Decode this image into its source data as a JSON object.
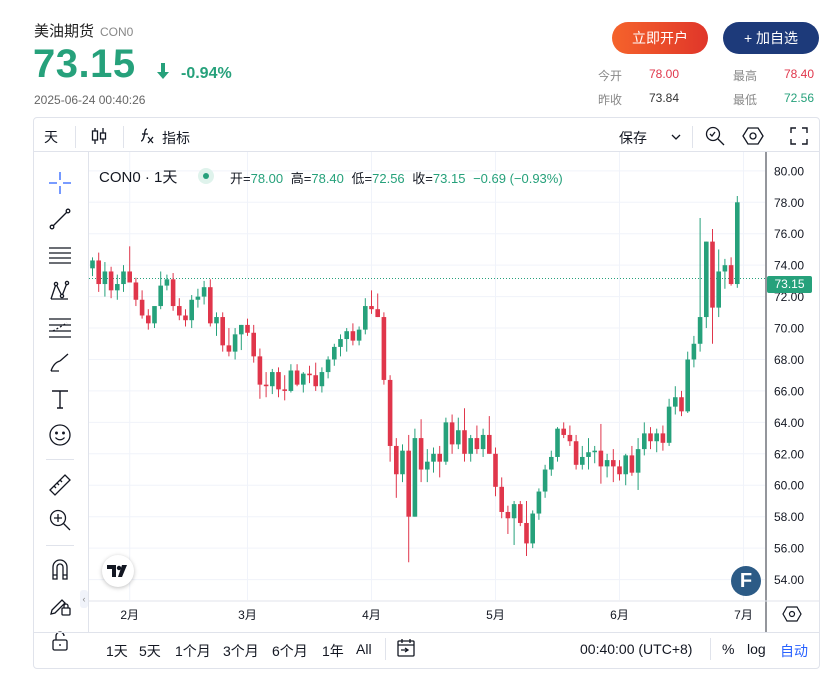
{
  "header": {
    "name": "美油期货",
    "code": "CON0",
    "price": "73.15",
    "change_pct": "-0.94%",
    "timestamp": "2025-06-24 00:40:26",
    "open_account_label": "立即开户",
    "add_watch_label": "+ 加自选"
  },
  "stats": {
    "open_label": "今开",
    "open_value": "78.00",
    "high_label": "最高",
    "high_value": "78.40",
    "prev_close_label": "昨收",
    "prev_close_value": "73.84",
    "low_label": "最低",
    "low_value": "72.56"
  },
  "toolbar": {
    "interval": "天",
    "indicators_label": "指标",
    "save_label": "保存"
  },
  "legend": {
    "symbol": "CON0 · 1天",
    "open_label": "开=",
    "open": "78.00",
    "high_label": "高=",
    "high": "78.40",
    "low_label": "低=",
    "low": "72.56",
    "close_label": "收=",
    "close": "73.15",
    "change": "−0.69 (−0.93%)"
  },
  "price_badge": "73.15",
  "bottom_bar": {
    "ranges": [
      "1天",
      "5天",
      "1个月",
      "3个月",
      "6个月",
      "1年",
      "All"
    ],
    "time": "00:40:00 (UTC+8)",
    "pct_label": "%",
    "log_label": "log",
    "auto_label": "自动"
  },
  "colors": {
    "up": "#26a17b",
    "down": "#e0364b",
    "accent": "#2962ff"
  },
  "chart_data": {
    "type": "candlestick",
    "y_ticks": [
      "80.00",
      "78.00",
      "76.00",
      "74.00",
      "72.00",
      "70.00",
      "68.00",
      "66.00",
      "64.00",
      "62.00",
      "60.00",
      "58.00",
      "56.00",
      "54.00"
    ],
    "ylim": [
      52.7,
      81.2
    ],
    "x_labels": [
      {
        "label": "2月",
        "index": 6
      },
      {
        "label": "3月",
        "index": 25
      },
      {
        "label": "4月",
        "index": 45
      },
      {
        "label": "5月",
        "index": 65
      },
      {
        "label": "6月",
        "index": 85
      },
      {
        "label": "7月",
        "index": 105
      }
    ],
    "last_price_line": 73.15,
    "candles": [
      {
        "o": 73.8,
        "h": 74.5,
        "l": 73.3,
        "c": 74.3
      },
      {
        "o": 74.3,
        "h": 74.8,
        "l": 72.3,
        "c": 72.8
      },
      {
        "o": 72.8,
        "h": 74.2,
        "l": 72.0,
        "c": 73.6
      },
      {
        "o": 73.6,
        "h": 73.9,
        "l": 71.9,
        "c": 72.4
      },
      {
        "o": 72.4,
        "h": 73.4,
        "l": 71.8,
        "c": 72.8
      },
      {
        "o": 72.8,
        "h": 74.0,
        "l": 72.3,
        "c": 73.6
      },
      {
        "o": 73.6,
        "h": 75.2,
        "l": 73.0,
        "c": 72.9
      },
      {
        "o": 72.9,
        "h": 73.2,
        "l": 71.4,
        "c": 71.8
      },
      {
        "o": 71.8,
        "h": 72.4,
        "l": 70.6,
        "c": 70.8
      },
      {
        "o": 70.8,
        "h": 71.2,
        "l": 69.9,
        "c": 70.3
      },
      {
        "o": 70.3,
        "h": 71.0,
        "l": 70.0,
        "c": 71.4
      },
      {
        "o": 71.4,
        "h": 73.6,
        "l": 71.2,
        "c": 72.7
      },
      {
        "o": 72.7,
        "h": 73.4,
        "l": 72.4,
        "c": 73.1
      },
      {
        "o": 73.1,
        "h": 73.5,
        "l": 71.1,
        "c": 71.4
      },
      {
        "o": 71.4,
        "h": 71.9,
        "l": 70.5,
        "c": 70.8
      },
      {
        "o": 70.8,
        "h": 71.2,
        "l": 70.1,
        "c": 70.5
      },
      {
        "o": 70.5,
        "h": 72.1,
        "l": 70.0,
        "c": 71.8
      },
      {
        "o": 71.8,
        "h": 72.5,
        "l": 71.3,
        "c": 72.0
      },
      {
        "o": 72.0,
        "h": 73.0,
        "l": 71.5,
        "c": 72.6
      },
      {
        "o": 72.6,
        "h": 73.1,
        "l": 70.1,
        "c": 70.3
      },
      {
        "o": 70.3,
        "h": 71.0,
        "l": 69.5,
        "c": 70.7
      },
      {
        "o": 70.7,
        "h": 71.0,
        "l": 68.5,
        "c": 68.9
      },
      {
        "o": 68.9,
        "h": 70.0,
        "l": 68.2,
        "c": 68.5
      },
      {
        "o": 68.5,
        "h": 70.0,
        "l": 68.0,
        "c": 69.6
      },
      {
        "o": 69.6,
        "h": 70.2,
        "l": 68.6,
        "c": 70.2
      },
      {
        "o": 70.2,
        "h": 70.6,
        "l": 69.5,
        "c": 69.7
      },
      {
        "o": 69.7,
        "h": 70.2,
        "l": 67.8,
        "c": 68.2
      },
      {
        "o": 68.2,
        "h": 68.7,
        "l": 65.5,
        "c": 66.4
      },
      {
        "o": 66.4,
        "h": 67.2,
        "l": 65.6,
        "c": 66.3
      },
      {
        "o": 66.3,
        "h": 67.4,
        "l": 65.8,
        "c": 67.2
      },
      {
        "o": 67.2,
        "h": 67.5,
        "l": 65.6,
        "c": 66.1
      },
      {
        "o": 66.1,
        "h": 67.0,
        "l": 65.4,
        "c": 66.0
      },
      {
        "o": 66.0,
        "h": 67.7,
        "l": 65.9,
        "c": 67.3
      },
      {
        "o": 67.3,
        "h": 67.7,
        "l": 66.3,
        "c": 66.4
      },
      {
        "o": 66.4,
        "h": 67.2,
        "l": 65.9,
        "c": 67.1
      },
      {
        "o": 67.1,
        "h": 67.6,
        "l": 66.5,
        "c": 67.0
      },
      {
        "o": 67.0,
        "h": 67.8,
        "l": 66.0,
        "c": 66.3
      },
      {
        "o": 66.3,
        "h": 67.5,
        "l": 65.9,
        "c": 67.2
      },
      {
        "o": 67.2,
        "h": 68.2,
        "l": 66.8,
        "c": 68.0
      },
      {
        "o": 68.0,
        "h": 69.0,
        "l": 67.6,
        "c": 68.8
      },
      {
        "o": 68.8,
        "h": 69.6,
        "l": 68.2,
        "c": 69.3
      },
      {
        "o": 69.3,
        "h": 70.0,
        "l": 68.5,
        "c": 69.8
      },
      {
        "o": 69.8,
        "h": 70.3,
        "l": 68.9,
        "c": 69.2
      },
      {
        "o": 69.2,
        "h": 70.1,
        "l": 68.9,
        "c": 69.9
      },
      {
        "o": 69.9,
        "h": 71.9,
        "l": 69.6,
        "c": 71.4
      },
      {
        "o": 71.4,
        "h": 72.4,
        "l": 70.9,
        "c": 71.2
      },
      {
        "o": 71.2,
        "h": 72.2,
        "l": 70.7,
        "c": 70.7
      },
      {
        "o": 70.7,
        "h": 71.0,
        "l": 66.4,
        "c": 66.7
      },
      {
        "o": 66.7,
        "h": 67.0,
        "l": 61.5,
        "c": 62.5
      },
      {
        "o": 62.5,
        "h": 63.0,
        "l": 59.2,
        "c": 60.7
      },
      {
        "o": 60.7,
        "h": 62.6,
        "l": 60.2,
        "c": 62.2
      },
      {
        "o": 62.2,
        "h": 63.2,
        "l": 55.1,
        "c": 58.0
      },
      {
        "o": 58.0,
        "h": 63.6,
        "l": 58.0,
        "c": 63.0
      },
      {
        "o": 63.0,
        "h": 64.2,
        "l": 60.2,
        "c": 61.0
      },
      {
        "o": 61.0,
        "h": 62.3,
        "l": 60.2,
        "c": 61.5
      },
      {
        "o": 61.5,
        "h": 62.4,
        "l": 60.8,
        "c": 62.0
      },
      {
        "o": 62.0,
        "h": 62.5,
        "l": 60.5,
        "c": 61.5
      },
      {
        "o": 61.5,
        "h": 64.3,
        "l": 61.3,
        "c": 64.0
      },
      {
        "o": 64.0,
        "h": 64.5,
        "l": 62.0,
        "c": 62.6
      },
      {
        "o": 62.6,
        "h": 64.3,
        "l": 62.3,
        "c": 63.5
      },
      {
        "o": 63.5,
        "h": 64.9,
        "l": 61.5,
        "c": 62.0
      },
      {
        "o": 62.0,
        "h": 63.2,
        "l": 61.5,
        "c": 63.0
      },
      {
        "o": 63.0,
        "h": 63.8,
        "l": 62.0,
        "c": 62.3
      },
      {
        "o": 62.3,
        "h": 63.6,
        "l": 61.8,
        "c": 63.2
      },
      {
        "o": 63.2,
        "h": 64.4,
        "l": 62.0,
        "c": 62.0
      },
      {
        "o": 62.0,
        "h": 62.4,
        "l": 59.3,
        "c": 59.9
      },
      {
        "o": 59.9,
        "h": 60.5,
        "l": 57.9,
        "c": 58.3
      },
      {
        "o": 58.3,
        "h": 58.7,
        "l": 56.9,
        "c": 57.9
      },
      {
        "o": 57.9,
        "h": 59.0,
        "l": 56.2,
        "c": 58.8
      },
      {
        "o": 58.8,
        "h": 59.0,
        "l": 57.4,
        "c": 57.6
      },
      {
        "o": 57.6,
        "h": 59.0,
        "l": 55.5,
        "c": 56.3
      },
      {
        "o": 56.3,
        "h": 58.4,
        "l": 56.0,
        "c": 58.2
      },
      {
        "o": 58.2,
        "h": 59.8,
        "l": 57.8,
        "c": 59.6
      },
      {
        "o": 59.6,
        "h": 61.3,
        "l": 59.2,
        "c": 61.0
      },
      {
        "o": 61.0,
        "h": 62.2,
        "l": 60.6,
        "c": 61.8
      },
      {
        "o": 61.8,
        "h": 63.7,
        "l": 61.5,
        "c": 63.6
      },
      {
        "o": 63.6,
        "h": 64.0,
        "l": 63.0,
        "c": 63.2
      },
      {
        "o": 63.2,
        "h": 63.8,
        "l": 62.5,
        "c": 62.8
      },
      {
        "o": 62.8,
        "h": 63.2,
        "l": 61.0,
        "c": 61.3
      },
      {
        "o": 61.3,
        "h": 62.5,
        "l": 61.0,
        "c": 61.8
      },
      {
        "o": 61.8,
        "h": 63.0,
        "l": 61.0,
        "c": 62.1
      },
      {
        "o": 62.1,
        "h": 62.5,
        "l": 61.4,
        "c": 62.2
      },
      {
        "o": 62.2,
        "h": 63.9,
        "l": 60.1,
        "c": 61.2
      },
      {
        "o": 61.2,
        "h": 62.0,
        "l": 60.5,
        "c": 61.6
      },
      {
        "o": 61.6,
        "h": 62.3,
        "l": 60.2,
        "c": 61.2
      },
      {
        "o": 61.2,
        "h": 61.6,
        "l": 60.3,
        "c": 60.7
      },
      {
        "o": 60.7,
        "h": 62.0,
        "l": 60.0,
        "c": 61.9
      },
      {
        "o": 61.9,
        "h": 62.5,
        "l": 60.6,
        "c": 60.8
      },
      {
        "o": 60.8,
        "h": 63.0,
        "l": 59.7,
        "c": 62.3
      },
      {
        "o": 62.3,
        "h": 64.0,
        "l": 61.9,
        "c": 63.3
      },
      {
        "o": 63.3,
        "h": 63.7,
        "l": 62.3,
        "c": 62.8
      },
      {
        "o": 62.8,
        "h": 63.6,
        "l": 62.1,
        "c": 63.3
      },
      {
        "o": 63.3,
        "h": 63.8,
        "l": 62.2,
        "c": 62.7
      },
      {
        "o": 62.7,
        "h": 65.5,
        "l": 62.5,
        "c": 65.0
      },
      {
        "o": 65.0,
        "h": 66.3,
        "l": 64.5,
        "c": 65.6
      },
      {
        "o": 65.6,
        "h": 66.0,
        "l": 64.4,
        "c": 64.7
      },
      {
        "o": 64.7,
        "h": 68.5,
        "l": 64.6,
        "c": 68.0
      },
      {
        "o": 68.0,
        "h": 69.5,
        "l": 67.5,
        "c": 69.0
      },
      {
        "o": 69.0,
        "h": 77.0,
        "l": 68.5,
        "c": 70.7
      },
      {
        "o": 70.7,
        "h": 75.5,
        "l": 70.0,
        "c": 75.5
      },
      {
        "o": 75.5,
        "h": 76.3,
        "l": 69.0,
        "c": 71.3
      },
      {
        "o": 71.3,
        "h": 75.0,
        "l": 70.7,
        "c": 73.6
      },
      {
        "o": 73.6,
        "h": 74.4,
        "l": 72.5,
        "c": 74.0
      },
      {
        "o": 74.0,
        "h": 74.5,
        "l": 72.7,
        "c": 72.8
      },
      {
        "o": 72.8,
        "h": 78.4,
        "l": 72.56,
        "c": 78.0
      }
    ]
  }
}
